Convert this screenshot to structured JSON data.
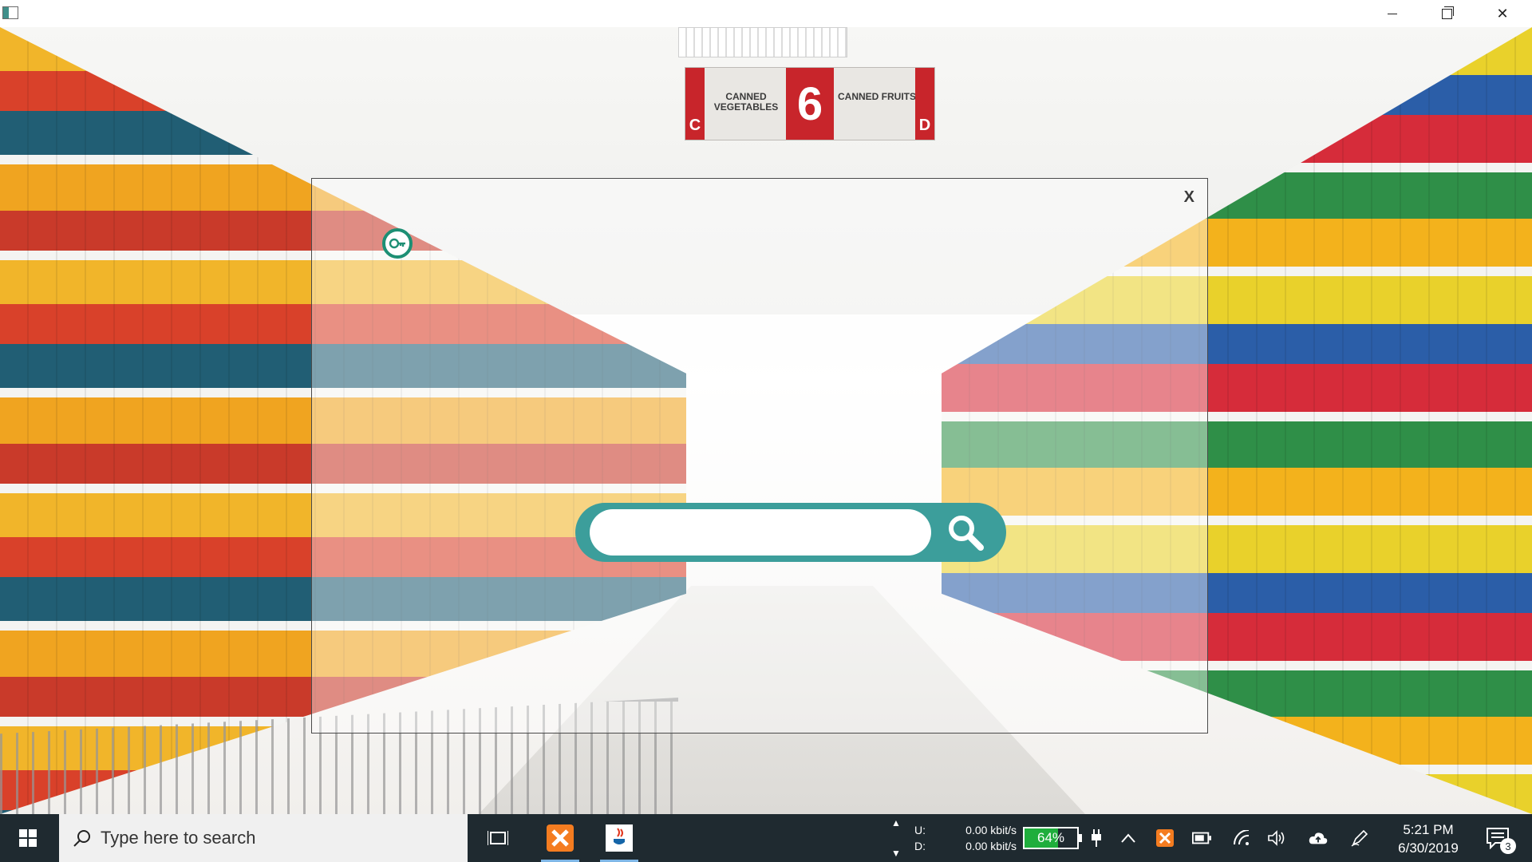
{
  "window": {
    "minimize_glyph": "",
    "close_glyph": "✕"
  },
  "scene": {
    "aisle_sign": {
      "left_letter": "C",
      "left_text": "CANNED VEGETABLES",
      "number": "6",
      "right_text": "CANNED FRUITS",
      "right_letter": "D"
    }
  },
  "dialog": {
    "close_label": "X",
    "search": {
      "value": "",
      "placeholder": ""
    },
    "icons": {
      "key": "key-icon",
      "search": "search-icon"
    },
    "accent_color": "#3c9e9b"
  },
  "taskbar": {
    "search_placeholder": "Type here to search",
    "net": {
      "up_label": "U:",
      "down_label": "D:",
      "up_value": "0.00 kbit/s",
      "down_value": "0.00 kbit/s"
    },
    "battery": {
      "percent_text": "64%",
      "level": 0.64,
      "color": "#1fae3c"
    },
    "clock": {
      "time": "5:21 PM",
      "date": "6/30/2019"
    },
    "notifications_count": "3",
    "pinned": [
      "task-view-icon",
      "xampp-icon",
      "java-icon"
    ],
    "tray": [
      "plug-icon",
      "chevron-up-icon",
      "xampp-tray-icon",
      "battery-tray-icon",
      "wifi-icon",
      "volume-icon",
      "cloud-upload-icon",
      "pen-icon"
    ]
  }
}
